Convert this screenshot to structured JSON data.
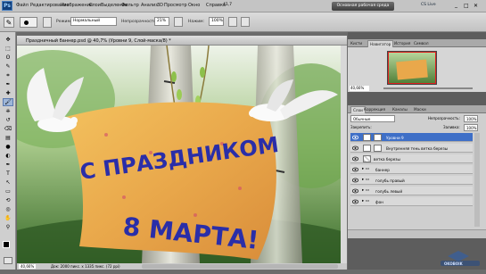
{
  "app": {
    "logo": "Ps",
    "zoom_value": "41,7",
    "workspace_button": "Основная рабочая среда",
    "cs_live": "CS Live"
  },
  "menu": [
    "Файл",
    "Редактирование",
    "Изображение",
    "Слои",
    "Выделение",
    "Фильтр",
    "Анализ",
    "3D",
    "Просмотр",
    "Окно",
    "Справка"
  ],
  "options": {
    "mode_label": "Режим:",
    "mode_value": "Нормальный",
    "opacity_label": "Непрозрачность:",
    "opacity_value": "21%",
    "press_label": "Нажим:",
    "press_value": "100%"
  },
  "document": {
    "title": "Праздничный баннер.psd @ 40,7% (Уровни 9, Слой-маска/8) *",
    "status_zoom": "40,66%",
    "status_doc": "Док: 2000 пикс. x 1335 пикс. (72 ppi)"
  },
  "banner": {
    "line1": "С ПРАЗДНИКОМ",
    "line2": "8 МАРТА!"
  },
  "navigator": {
    "tabs": [
      "Кисти",
      "Навигатор",
      "История",
      "Символ"
    ],
    "active_tab": "Навигатор",
    "zoom": "40,66%"
  },
  "layers_panel": {
    "tabs": [
      "Слои",
      "Коррекция",
      "Каналы",
      "Маски"
    ],
    "active_tab": "Слои",
    "blend_mode": "Обычные",
    "opacity_label": "Непрозрачность:",
    "opacity_value": "100%",
    "lock_label": "Закрепить:",
    "fill_label": "Заливка:",
    "fill_value": "100%",
    "layers": [
      {
        "name": "Уровни 9",
        "selected": true
      },
      {
        "name": "Внутренняя тень ветка березы",
        "selected": false
      },
      {
        "name": "ветка березы",
        "selected": false
      },
      {
        "name": "баннер",
        "selected": false
      },
      {
        "name": "голубь правый",
        "selected": false
      },
      {
        "name": "голубь левый",
        "selected": false
      },
      {
        "name": "фон",
        "selected": false
      }
    ]
  },
  "watermark": "OKOBOIK",
  "colors": {
    "menubar": "#c4c4c4",
    "panel_bg": "#5d5d5d",
    "selected_layer": "#3e6fc7",
    "banner_text": "#2a2ea8",
    "banner_fill": "#e8a94a"
  }
}
